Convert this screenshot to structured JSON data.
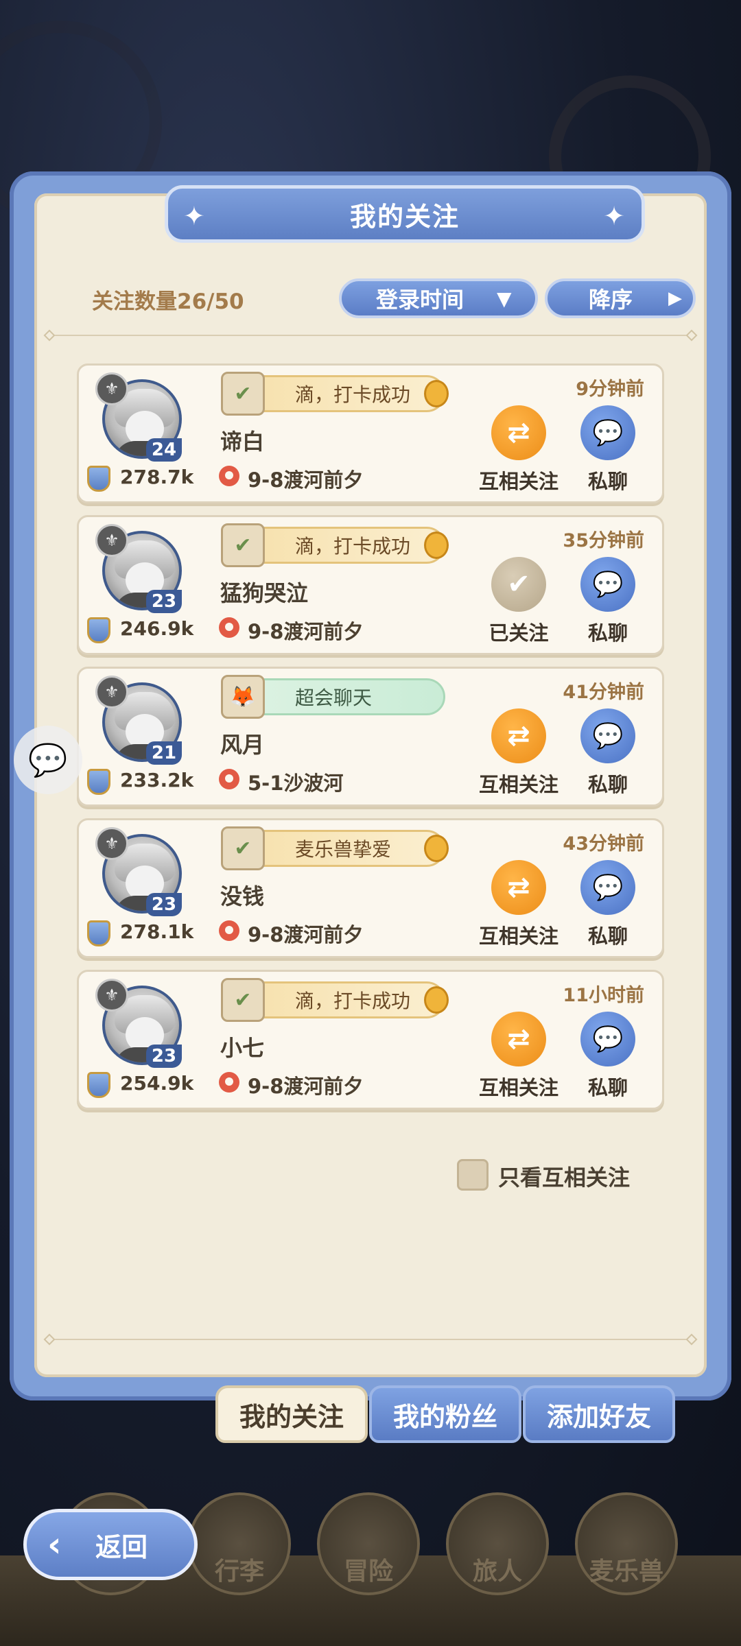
{
  "panel": {
    "title": "我的关注",
    "follow_count": "关注数量26/50",
    "sort_field": "登录时间",
    "sort_order": "降序"
  },
  "friends": [
    {
      "level": "24",
      "power": "278.7k",
      "tag": "滴，打卡成功",
      "tag_style": "gold",
      "name": "谛白",
      "location": "9-8渡河前夕",
      "time": "9分钟前",
      "follow_label": "互相关注",
      "follow_state": "mutual",
      "chat_label": "私聊"
    },
    {
      "level": "23",
      "power": "246.9k",
      "tag": "滴，打卡成功",
      "tag_style": "gold",
      "name": "猛狗哭泣",
      "location": "9-8渡河前夕",
      "time": "35分钟前",
      "follow_label": "已关注",
      "follow_state": "followed",
      "chat_label": "私聊"
    },
    {
      "level": "21",
      "power": "233.2k",
      "tag": "超会聊天",
      "tag_style": "green",
      "name": "风月",
      "location": "5-1沙波河",
      "time": "41分钟前",
      "follow_label": "互相关注",
      "follow_state": "mutual",
      "chat_label": "私聊"
    },
    {
      "level": "23",
      "power": "278.1k",
      "tag": "麦乐兽挚爱",
      "tag_style": "gold",
      "name": "没钱",
      "location": "9-8渡河前夕",
      "time": "43分钟前",
      "follow_label": "互相关注",
      "follow_state": "mutual",
      "chat_label": "私聊"
    },
    {
      "level": "23",
      "power": "254.9k",
      "tag": "滴，打卡成功",
      "tag_style": "gold",
      "name": "小七",
      "location": "9-8渡河前夕",
      "time": "11小时前",
      "follow_label": "互相关注",
      "follow_state": "mutual",
      "chat_label": "私聊"
    }
  ],
  "filter": {
    "label": "只看互相关注",
    "checked": false
  },
  "tabs": [
    {
      "label": "我的关注",
      "active": true
    },
    {
      "label": "我的粉丝",
      "active": false
    },
    {
      "label": "添加好友",
      "active": false
    }
  ],
  "back_label": "返回",
  "bottom_nav": [
    "行李",
    "冒险",
    "旅人",
    "麦乐兽"
  ],
  "colors": {
    "accent_blue": "#5d7fc4",
    "accent_orange": "#ec8d18",
    "panel_bg": "#f2ecdc"
  }
}
